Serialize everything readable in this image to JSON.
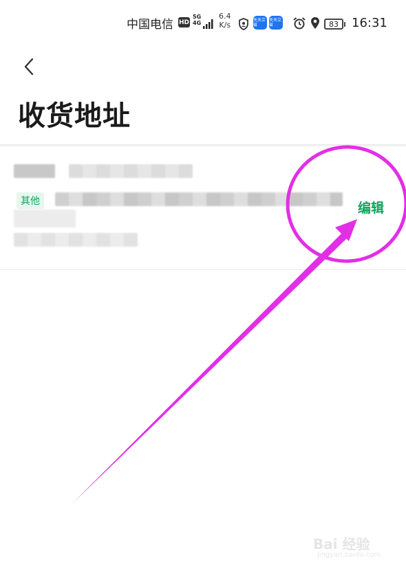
{
  "status_bar": {
    "carrier": "中国电信",
    "hd": "HD",
    "network": "5G",
    "network_sub": "4G",
    "speed_value": "6.4",
    "speed_unit": "K/s",
    "app_icon_1": "天天立省",
    "app_icon_2": "天天立省",
    "battery": "83",
    "time": "16:31",
    "icons": [
      "signal-icon",
      "shield-icon",
      "alarm-icon",
      "location-icon",
      "battery-icon"
    ]
  },
  "nav": {
    "back_icon": "chevron-left-icon",
    "title": "收货地址"
  },
  "address": {
    "tag": "其他",
    "edit_label": "编辑"
  },
  "annotation": {
    "color": "#e22fe6",
    "shapes": [
      "highlight-circle",
      "pointer-arrow"
    ]
  },
  "watermark": {
    "main": "Bai 经验",
    "sub": "jingyan.baidu.com"
  },
  "colors": {
    "accent_green": "#16a35f",
    "tag_bg": "#e7f6ee"
  }
}
